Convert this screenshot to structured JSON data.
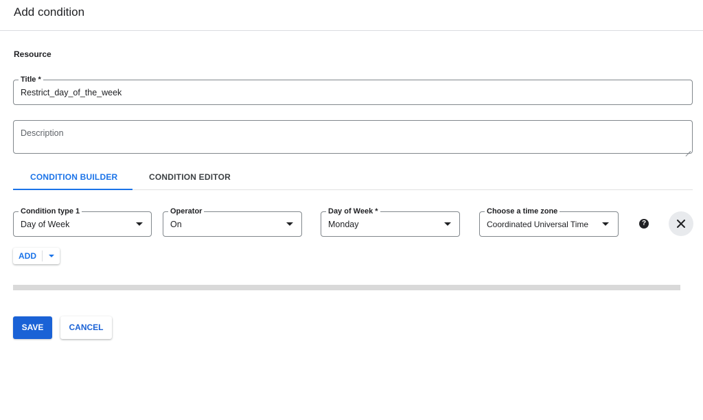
{
  "dialog": {
    "title": "Add condition"
  },
  "resource": {
    "label": "Resource"
  },
  "title_field": {
    "label": "Title *",
    "value": "Restrict_day_of_the_week"
  },
  "description_field": {
    "placeholder": "Description",
    "value": ""
  },
  "tabs": [
    {
      "label": "CONDITION BUILDER",
      "active": true
    },
    {
      "label": "CONDITION EDITOR",
      "active": false
    }
  ],
  "condition": {
    "type": {
      "label": "Condition type 1",
      "value": "Day of Week"
    },
    "operator": {
      "label": "Operator",
      "value": "On"
    },
    "day_of_week": {
      "label": "Day of Week *",
      "value": "Monday"
    },
    "time_zone": {
      "label": "Choose a time zone",
      "value": "Coordinated Universal Time"
    },
    "help_icon": "help-icon",
    "remove_icon": "close-icon"
  },
  "add_button": {
    "label": "ADD"
  },
  "actions": {
    "save_label": "SAVE",
    "cancel_label": "CANCEL"
  },
  "colors": {
    "accent": "#1a73e8",
    "primary_button": "#1a62d6",
    "border": "#80868b",
    "progress_track": "#d9d9d9"
  }
}
